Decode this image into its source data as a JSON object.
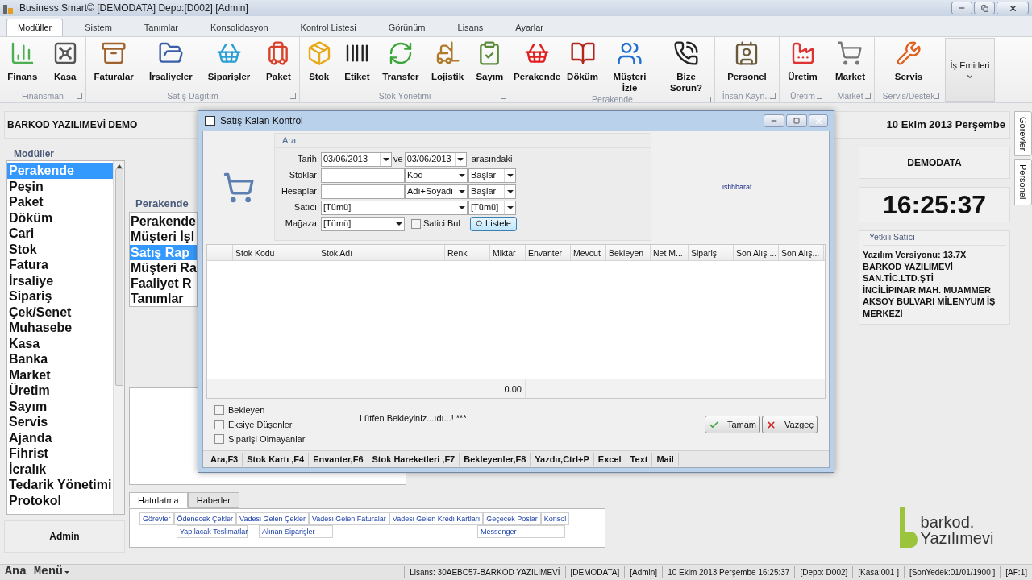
{
  "window": {
    "title": "Business Smart© [DEMODATA] Depo:[D002] [Admin]"
  },
  "menu_tabs": [
    {
      "label": "Modüller",
      "selected": true
    },
    {
      "label": "Sistem",
      "selected": false
    },
    {
      "label": "Tanımlar",
      "selected": false
    },
    {
      "label": "Konsolidasyon",
      "selected": false
    },
    {
      "label": "Kontrol Listesi",
      "selected": false
    },
    {
      "label": "Görünüm",
      "selected": false
    },
    {
      "label": "Lisans",
      "selected": false
    },
    {
      "label": "Ayarlar",
      "selected": false
    }
  ],
  "ribbon_groups": [
    {
      "label": "Finansman",
      "buttons": [
        "Finans",
        "Kasa"
      ]
    },
    {
      "label": "Satış Dağıtım",
      "buttons": [
        "Faturalar",
        "İrsaliyeler",
        "Siparişler",
        "Paket"
      ]
    },
    {
      "label": "Stok Yönetimi",
      "buttons": [
        "Stok",
        "Etiket",
        "Transfer",
        "Lojistik",
        "Sayım"
      ]
    },
    {
      "label": "Perakende",
      "buttons": [
        "Perakende",
        "Döküm",
        "Müşteri İzle",
        "Bize Sorun?"
      ]
    },
    {
      "label": "İnsan Kayn...",
      "buttons": [
        "Personel"
      ]
    },
    {
      "label": "Üretim",
      "buttons": [
        "Üretim"
      ]
    },
    {
      "label": "Market",
      "buttons": [
        "Market"
      ]
    },
    {
      "label": "Servis/Destek",
      "buttons": [
        "Servis"
      ]
    }
  ],
  "work_orders_button": {
    "label": "İş Emirleri"
  },
  "company_header": "BARKOD YAZILIMEVİ DEMO",
  "current_date": "10 Ekim 2013 Perşembe",
  "modules": {
    "title": "Modüller",
    "items": [
      {
        "label": "Perakende",
        "selected": true
      },
      {
        "label": "Peşin",
        "selected": false
      },
      {
        "label": "Paket",
        "selected": false
      },
      {
        "label": "Döküm",
        "selected": false
      },
      {
        "label": "Cari",
        "selected": false
      },
      {
        "label": "Stok",
        "selected": false
      },
      {
        "label": "Fatura",
        "selected": false
      },
      {
        "label": "İrsaliye",
        "selected": false
      },
      {
        "label": "Sipariş",
        "selected": false
      },
      {
        "label": "Çek/Senet",
        "selected": false
      },
      {
        "label": "Muhasebe",
        "selected": false
      },
      {
        "label": "Kasa",
        "selected": false
      },
      {
        "label": "Banka",
        "selected": false
      },
      {
        "label": "Market",
        "selected": false
      },
      {
        "label": "Üretim",
        "selected": false
      },
      {
        "label": "Sayım",
        "selected": false
      },
      {
        "label": "Servis",
        "selected": false
      },
      {
        "label": "Ajanda",
        "selected": false
      },
      {
        "label": "Fihrist",
        "selected": false
      },
      {
        "label": "İcralık",
        "selected": false
      },
      {
        "label": "Tedarik Yönetimi",
        "selected": false
      },
      {
        "label": "Protokol",
        "selected": false
      }
    ]
  },
  "user": "Admin",
  "sub_panel": {
    "title": "Perakende",
    "items": [
      {
        "label": "Perakende",
        "selected": false
      },
      {
        "label": "Müşteri İşl",
        "selected": false
      },
      {
        "label": "Satış Rap",
        "selected": true
      },
      {
        "label": "Müşteri Ra",
        "selected": false
      },
      {
        "label": "Faaliyet R",
        "selected": false
      },
      {
        "label": "Tanımlar",
        "selected": false
      }
    ]
  },
  "reminder_tabs": [
    {
      "label": "Hatırlatma",
      "selected": true
    },
    {
      "label": "Haberler",
      "selected": false
    }
  ],
  "reminder_links": {
    "row_1": [
      "Görevler",
      "Ödenecek Çekler",
      "Vadesi Gelen Çekler",
      "Vadesi Gelen Faturalar",
      "Vadesi Gelen Kredi Kartları",
      "Geçecek Poslar",
      "Konsol"
    ],
    "row_2": [
      "Yapılacak Teslimatlar",
      "Alınan Siparişler",
      "Messenger"
    ]
  },
  "database": "DEMODATA",
  "clock": "16:25:37",
  "info_box": {
    "title": "Yetkili Satıcı",
    "lines": [
      "Yazılım Versiyonu: 13.7X",
      "BARKOD YAZILIMEVİ",
      "SAN.TİC.LTD.ŞTİ",
      "İNCİLİPINAR MAH. MUAMMER",
      "AKSOY BULVARI MİLENYUM İŞ",
      "MERKEZİ"
    ]
  },
  "side_tabs": [
    "Görevler",
    "Personel"
  ],
  "logo": {
    "brand": "barkod.",
    "sub": "Yazılımevi"
  },
  "dialog": {
    "title": "Satış Kalan Kontrol",
    "group_title": "Ara",
    "date_label": "Tarih:",
    "date_from": "03/06/2013",
    "date_joiner": "ve",
    "date_to": "03/06/2013",
    "date_suffix": "arasındaki",
    "rows": [
      {
        "label": "Stoklar:",
        "value_1": "Kod",
        "value_2": "Başlar"
      },
      {
        "label": "Hesaplar:",
        "value_1": "Adı+Soyadı",
        "value_2": "Başlar"
      }
    ],
    "seller_label": "Satıcı:",
    "seller": "[Tümü]",
    "seller_2": "[Tümü]",
    "store_label": "Mağaza:",
    "store": "[Tümü]",
    "find_seller": {
      "label": "Satici Bul",
      "checked": false
    },
    "list_button": "Listele",
    "intel_link": "istihbarat...",
    "columns": [
      "Stok Kodu",
      "Stok Adı",
      "Renk",
      "Miktar",
      "Envanter",
      "Mevcut",
      "Bekleyen",
      "Net M...",
      "Sipariş",
      "Son Alış ...",
      "Son Alış..."
    ],
    "total": "0.00",
    "options": [
      {
        "label": "Bekleyen",
        "checked": false
      },
      {
        "label": "Eksiye Düşenler",
        "checked": false
      },
      {
        "label": "Siparişi Olmayanlar",
        "checked": false
      }
    ],
    "status": "Lütfen Bekleyiniz...ıdı...! ***",
    "ok_button": "Tamam",
    "cancel_button": "Vazgeç",
    "shortcuts": [
      "Ara,F3",
      "Stok Kartı ,F4",
      "Envanter,F6",
      "Stok Hareketleri ,F7",
      "Bekleyenler,F8",
      "Yazdır,Ctrl+P",
      "Excel",
      "Text",
      "Mail"
    ]
  },
  "status_bar": {
    "menu": "Ana Menü",
    "fields": [
      "Lisans: 30AEBC57-BARKOD YAZILIMEVİ",
      "[DEMODATA]",
      "[Admin]",
      "10 Ekim 2013 Perşembe 16:25:37",
      "[Depo: D002]",
      "[Kasa:001 ]",
      "[SonYedek:01/01/1900 ]",
      "[AF:1]"
    ]
  }
}
